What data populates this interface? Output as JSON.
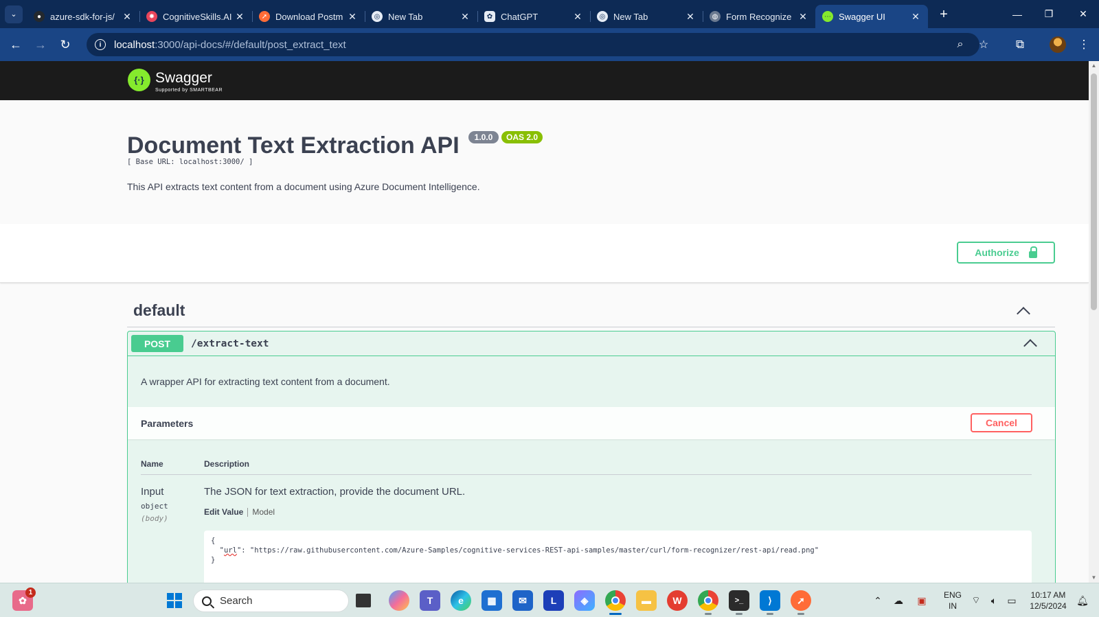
{
  "browser": {
    "tabs": [
      {
        "title": "azure-sdk-for-js/",
        "icon": "github-icon",
        "color": "#24292e"
      },
      {
        "title": "CognitiveSkills.AI",
        "icon": "ai-icon",
        "color": "#e8455b"
      },
      {
        "title": "Download Postm",
        "icon": "postman-icon",
        "color": "#ff6c37"
      },
      {
        "title": "New Tab",
        "icon": "chrome-icon",
        "color": "#5f6368"
      },
      {
        "title": "ChatGPT",
        "icon": "chatgpt-icon",
        "color": "#5f6368"
      },
      {
        "title": "New Tab",
        "icon": "chrome-icon",
        "color": "#5f6368"
      },
      {
        "title": "Form Recognize",
        "icon": "globe-icon",
        "color": "#5f6368"
      },
      {
        "title": "Swagger UI",
        "icon": "swagger-icon",
        "color": "#85ea2d"
      }
    ],
    "active_tab_index": 7,
    "url_host": "localhost",
    "url_path": ":3000/api-docs/#/default/post_extract_text"
  },
  "swagger": {
    "logo_text": "Swagger",
    "logo_sub": "Supported by SMARTBEAR",
    "title": "Document Text Extraction API",
    "version": "1.0.0",
    "oas": "OAS 2.0",
    "base_url": "[ Base URL: localhost:3000/ ]",
    "description": "This API extracts text content from a document using Azure Document Intelligence.",
    "authorize_label": "Authorize",
    "tag": "default",
    "operation": {
      "method": "POST",
      "path": "/extract-text",
      "description": "A wrapper API for extracting text content from a document.",
      "parameters_title": "Parameters",
      "cancel_label": "Cancel",
      "col_name": "Name",
      "col_description": "Description",
      "param": {
        "name": "Input",
        "type": "object",
        "in": "(body)",
        "description": "The JSON for text extraction, provide the document URL.",
        "tab_edit": "Edit Value",
        "tab_model": "Model",
        "body_open": "{",
        "body_key": "url",
        "body_value": "\"https://raw.githubusercontent.com/Azure-Samples/cognitive-services-REST-api-samples/master/curl/form-recognizer/rest-api/read.png\"",
        "body_close": "}"
      }
    },
    "colors": {
      "post": "#49cc90",
      "cancel": "#ff6060",
      "badge_version": "#7d8492",
      "badge_oas": "#89bf04"
    }
  },
  "taskbar": {
    "search_placeholder": "Search",
    "notification_badge": "1",
    "language": "ENG",
    "region": "IN",
    "time": "10:17 AM",
    "date": "12/5/2024",
    "apps": [
      "start-icon",
      "task-view-icon",
      "copilot-icon",
      "teams-icon",
      "edge-icon",
      "store-icon",
      "mail-icon",
      "l-app-icon",
      "copilot-app-icon",
      "chrome-icon",
      "file-explorer-icon",
      "wps-icon",
      "chrome-profile-icon",
      "terminal-icon",
      "vscode-icon",
      "postman-icon"
    ]
  }
}
